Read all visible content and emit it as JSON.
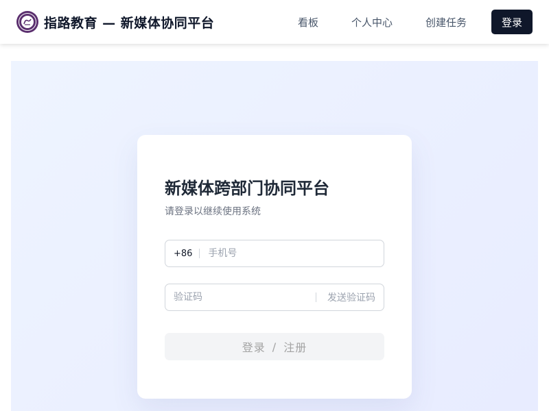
{
  "header": {
    "brand_title": "指路教育 — 新媒体协同平台",
    "logo_icon": "school-emblem-icon",
    "nav": {
      "board": "看板",
      "profile": "个人中心",
      "create_task": "创建任务"
    },
    "login_label": "登录"
  },
  "login_card": {
    "title": "新媒体跨部门协同平台",
    "subtitle": "请登录以继续使用系统",
    "phone": {
      "prefix": "+86",
      "placeholder": "手机号",
      "value": ""
    },
    "code": {
      "placeholder": "验证码",
      "value": "",
      "send_label": "发送验证码"
    },
    "submit": {
      "login": "登录",
      "separator": "/",
      "register": "注册"
    }
  },
  "colors": {
    "primary": "#0f172a",
    "logo": "#5b2f6e",
    "stage_gradient_start": "#eef4ff",
    "stage_gradient_end": "#e8ecff",
    "disabled_button": "#f3f4f6"
  }
}
